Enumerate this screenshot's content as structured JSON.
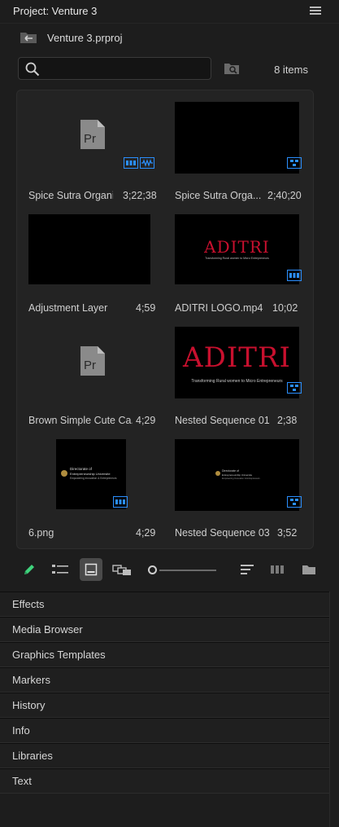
{
  "panel": {
    "title": "Project: Venture 3"
  },
  "project": {
    "file_name": "Venture 3.prproj"
  },
  "search": {
    "value": "",
    "placeholder": ""
  },
  "item_count": "8 items",
  "tiles": [
    {
      "name": "Spice Sutra Organi...",
      "duration": "3;22;38",
      "kind": "pr-file"
    },
    {
      "name": "Spice Sutra Orga...",
      "duration": "2;40;20",
      "kind": "sequence"
    },
    {
      "name": "Adjustment Layer",
      "duration": "4;59",
      "kind": "adjustment"
    },
    {
      "name": "ADITRI LOGO.mp4",
      "duration": "10;02",
      "kind": "video"
    },
    {
      "name": "Brown Simple Cute Ca...",
      "duration": "4;29",
      "kind": "pr-file"
    },
    {
      "name": "Nested Sequence 01",
      "duration": "2;38",
      "kind": "sequence"
    },
    {
      "name": "6.png",
      "duration": "4;29",
      "kind": "image"
    },
    {
      "name": "Nested Sequence 03",
      "duration": "3;52",
      "kind": "sequence"
    }
  ],
  "thumb_text": {
    "aditri_logo": "ADITRI",
    "aditri_sub_small": "Transforming Rural women to Micro Entrepreneurs",
    "aditri_sub_large": "Transforming Rural women to Micro Entrepreneurs",
    "directorate_line1": "Directorate of",
    "directorate_line2": "Entrepreneurship Universite",
    "directorate_line3": "Empowering Innovation & Entrepreneurs"
  },
  "pr_glyph": "Pr",
  "panels": [
    "Effects",
    "Media Browser",
    "Graphics Templates",
    "Markers",
    "History",
    "Info",
    "Libraries",
    "Text"
  ],
  "colors": {
    "accent_blue": "#2b8fff",
    "logo_red": "#c8102e",
    "pencil_green": "#3fd37d"
  },
  "icons": {
    "panel_menu": "hamburger-icon",
    "back_folder": "folder-up-icon",
    "search": "search-icon",
    "find_bin": "find-in-bin-icon",
    "write_on": "pencil-icon",
    "list_view": "list-view-icon",
    "icon_view": "icon-view-icon",
    "freeform_view": "freeform-view-icon",
    "sort": "sort-icon",
    "automate": "automate-to-sequence-icon",
    "new_bin": "new-bin-icon"
  }
}
